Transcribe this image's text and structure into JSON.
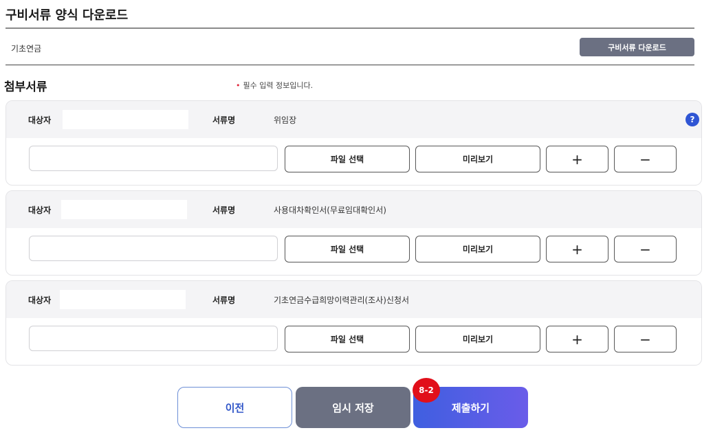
{
  "download_section": {
    "title": "구비서류 양식 다운로드",
    "row_label": "기초연금",
    "download_button": "구비서류 다운로드"
  },
  "attachments": {
    "title": "첨부서류",
    "required_note": "필수 입력 정보입니다.",
    "required_mark": "•",
    "target_label": "대상자",
    "doc_name_label": "서류명",
    "help_symbol": "?",
    "file_select": "파일 선택",
    "preview": "미리보기",
    "add": "+",
    "remove": "−",
    "items": [
      {
        "target": "",
        "doc_name": "위임장"
      },
      {
        "target": "",
        "doc_name": "사용대차확인서(무료임대확인서)"
      },
      {
        "target": "",
        "doc_name": "기초연금수급희망이력관리(조사)신청서"
      }
    ]
  },
  "footer": {
    "prev": "이전",
    "temp_save": "임시 저장",
    "submit": "제출하기",
    "step_badge": "8-2"
  },
  "colors": {
    "primary": "#3f5fe0",
    "gray_button": "#6b7082",
    "badge": "#e10f1a",
    "required": "#e0263a"
  }
}
